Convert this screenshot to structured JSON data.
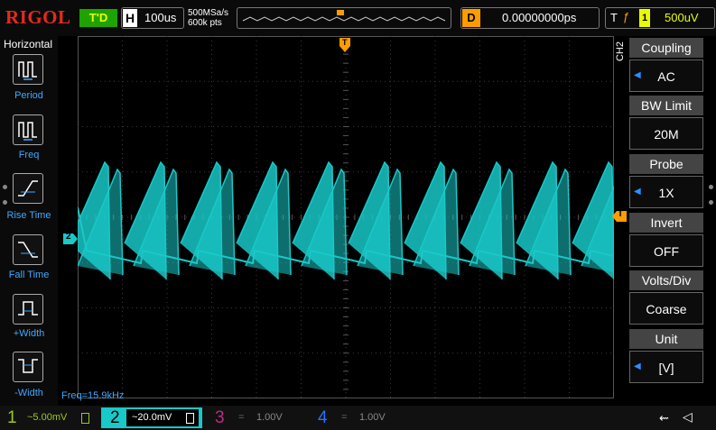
{
  "header": {
    "logo": "RIGOL",
    "run_status": "T'D",
    "timebase_label": "H",
    "timebase": "100us",
    "sample_rate": "500MSa/s",
    "memory_depth": "600k pts",
    "delay_label": "D",
    "delay": "0.00000000ps",
    "trigger_label": "T",
    "trigger_source": "1",
    "trigger_level": "500uV"
  },
  "left_menu": {
    "title": "Horizontal",
    "items": [
      {
        "label": "Period",
        "icon": "period-icon"
      },
      {
        "label": "Freq",
        "icon": "frequency-icon"
      },
      {
        "label": "Rise Time",
        "icon": "rise-time-icon"
      },
      {
        "label": "Fall Time",
        "icon": "fall-time-icon"
      },
      {
        "label": "+Width",
        "icon": "positive-width-icon"
      },
      {
        "label": "-Width",
        "icon": "negative-width-icon"
      }
    ]
  },
  "right_menu": {
    "channel_tag": "CH2",
    "items": [
      {
        "label": "Coupling",
        "value": "AC",
        "arrow": true
      },
      {
        "label": "BW Limit",
        "value": "20M",
        "arrow": false
      },
      {
        "label": "Probe",
        "value": "1X",
        "arrow": true
      },
      {
        "label": "Invert",
        "value": "OFF",
        "arrow": false
      },
      {
        "label": "Volts/Div",
        "value": "Coarse",
        "arrow": false
      },
      {
        "label": "Unit",
        "value": "[V]",
        "arrow": true
      }
    ]
  },
  "screen": {
    "channel_marker": "2",
    "trigger_marker": "T",
    "measurement": "Freq=15.9kHz",
    "trace_color": "#19c8c8"
  },
  "bottom": {
    "channels": [
      {
        "num": "1",
        "scale": "~5.00mV",
        "color": "#9ac91d"
      },
      {
        "num": "2",
        "scale": "~20.0mV",
        "color": "#19c8c8"
      },
      {
        "num": "3",
        "scale": "1.00V",
        "color": "#c02a7e"
      },
      {
        "num": "4",
        "scale": "1.00V",
        "color": "#2b6fff"
      }
    ]
  },
  "colors": {
    "ch1": "#9ac91d",
    "ch2": "#19c8c8",
    "trigger": "#ff9c00",
    "menu_label": "#3ea9ff"
  }
}
